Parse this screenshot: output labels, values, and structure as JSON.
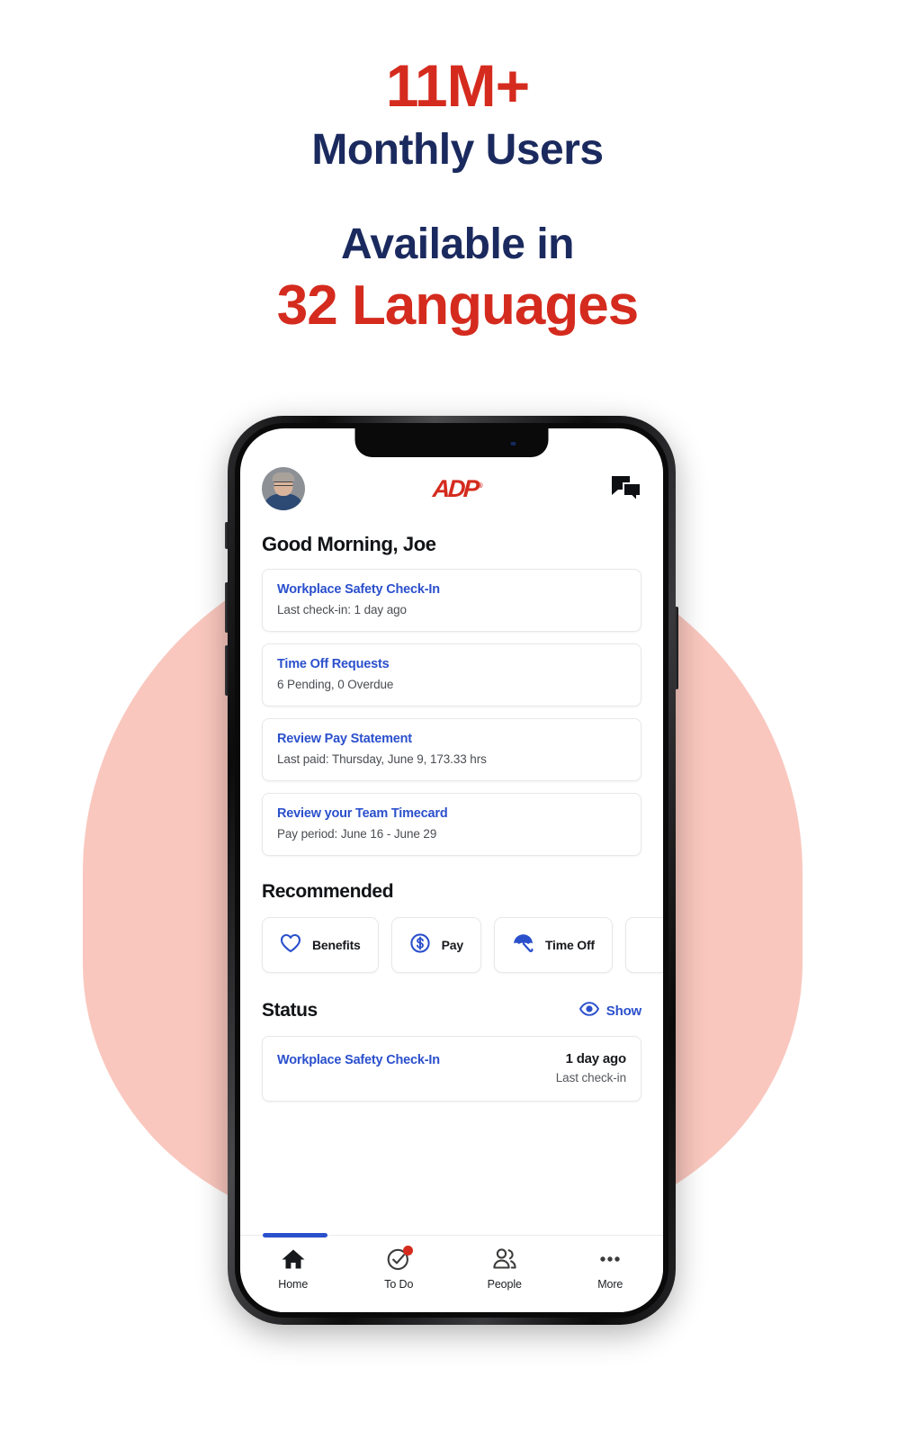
{
  "promo": {
    "stat_number": "11M+",
    "stat_label": "Monthly Users",
    "available_label": "Available in",
    "languages_label": "32 Languages",
    "colors": {
      "red": "#D42B1E",
      "navy": "#1B2A5E",
      "blob_pink": "#F9C7BE",
      "link_blue": "#2B50CC"
    }
  },
  "app": {
    "header": {
      "avatar": "user-avatar",
      "logo_text": "ADP",
      "logo_trademark": "®",
      "chat_icon": "chat-bubbles-icon"
    },
    "greeting": "Good Morning, Joe",
    "tasks": [
      {
        "title": "Workplace Safety Check-In",
        "subtitle": "Last check-in: 1 day ago"
      },
      {
        "title": "Time Off Requests",
        "subtitle": "6 Pending, 0 Overdue"
      },
      {
        "title": "Review Pay Statement",
        "subtitle": "Last paid: Thursday, June 9, 173.33 hrs"
      },
      {
        "title": "Review your Team Timecard",
        "subtitle": "Pay period: June 16 - June 29"
      }
    ],
    "recommended": {
      "heading": "Recommended",
      "chips": [
        {
          "label": "Benefits",
          "icon": "heart-icon"
        },
        {
          "label": "Pay",
          "icon": "dollar-circle-icon"
        },
        {
          "label": "Time Off",
          "icon": "umbrella-icon"
        },
        {
          "label": "",
          "icon": "partial-chip"
        }
      ]
    },
    "status": {
      "heading": "Status",
      "show_label": "Show",
      "show_icon": "eye-icon",
      "items": [
        {
          "title": "Workplace Safety Check-In",
          "value": "1 day ago",
          "caption": "Last check-in"
        }
      ]
    },
    "tabbar": [
      {
        "label": "Home",
        "icon": "home-icon",
        "active": true,
        "badge": false
      },
      {
        "label": "To Do",
        "icon": "check-circle-icon",
        "active": false,
        "badge": true
      },
      {
        "label": "People",
        "icon": "people-icon",
        "active": false,
        "badge": false
      },
      {
        "label": "More",
        "icon": "ellipsis-icon",
        "active": false,
        "badge": false
      }
    ]
  }
}
